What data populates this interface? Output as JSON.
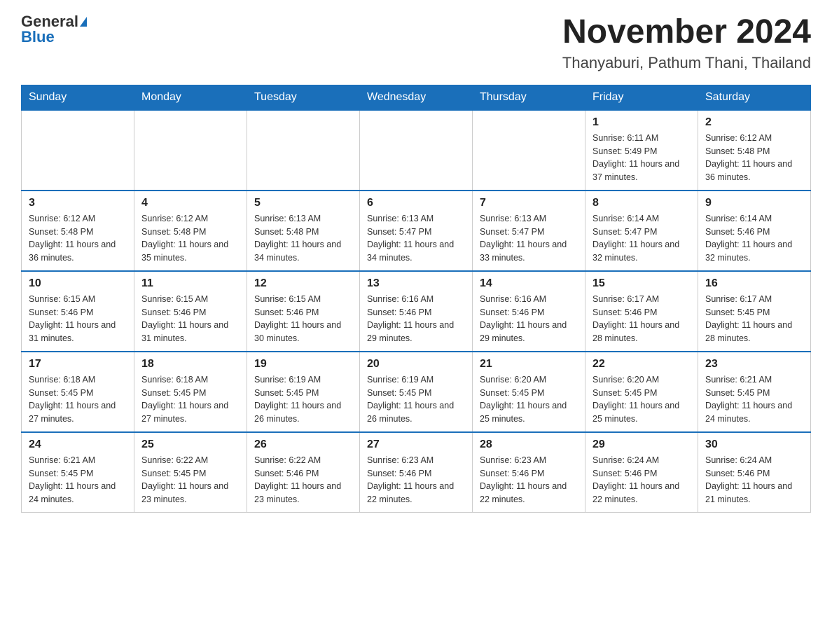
{
  "header": {
    "logo_general": "General",
    "logo_blue": "Blue",
    "month_title": "November 2024",
    "location": "Thanyaburi, Pathum Thani, Thailand"
  },
  "weekdays": [
    "Sunday",
    "Monday",
    "Tuesday",
    "Wednesday",
    "Thursday",
    "Friday",
    "Saturday"
  ],
  "weeks": [
    [
      {
        "day": "",
        "info": ""
      },
      {
        "day": "",
        "info": ""
      },
      {
        "day": "",
        "info": ""
      },
      {
        "day": "",
        "info": ""
      },
      {
        "day": "",
        "info": ""
      },
      {
        "day": "1",
        "info": "Sunrise: 6:11 AM\nSunset: 5:49 PM\nDaylight: 11 hours and 37 minutes."
      },
      {
        "day": "2",
        "info": "Sunrise: 6:12 AM\nSunset: 5:48 PM\nDaylight: 11 hours and 36 minutes."
      }
    ],
    [
      {
        "day": "3",
        "info": "Sunrise: 6:12 AM\nSunset: 5:48 PM\nDaylight: 11 hours and 36 minutes."
      },
      {
        "day": "4",
        "info": "Sunrise: 6:12 AM\nSunset: 5:48 PM\nDaylight: 11 hours and 35 minutes."
      },
      {
        "day": "5",
        "info": "Sunrise: 6:13 AM\nSunset: 5:48 PM\nDaylight: 11 hours and 34 minutes."
      },
      {
        "day": "6",
        "info": "Sunrise: 6:13 AM\nSunset: 5:47 PM\nDaylight: 11 hours and 34 minutes."
      },
      {
        "day": "7",
        "info": "Sunrise: 6:13 AM\nSunset: 5:47 PM\nDaylight: 11 hours and 33 minutes."
      },
      {
        "day": "8",
        "info": "Sunrise: 6:14 AM\nSunset: 5:47 PM\nDaylight: 11 hours and 32 minutes."
      },
      {
        "day": "9",
        "info": "Sunrise: 6:14 AM\nSunset: 5:46 PM\nDaylight: 11 hours and 32 minutes."
      }
    ],
    [
      {
        "day": "10",
        "info": "Sunrise: 6:15 AM\nSunset: 5:46 PM\nDaylight: 11 hours and 31 minutes."
      },
      {
        "day": "11",
        "info": "Sunrise: 6:15 AM\nSunset: 5:46 PM\nDaylight: 11 hours and 31 minutes."
      },
      {
        "day": "12",
        "info": "Sunrise: 6:15 AM\nSunset: 5:46 PM\nDaylight: 11 hours and 30 minutes."
      },
      {
        "day": "13",
        "info": "Sunrise: 6:16 AM\nSunset: 5:46 PM\nDaylight: 11 hours and 29 minutes."
      },
      {
        "day": "14",
        "info": "Sunrise: 6:16 AM\nSunset: 5:46 PM\nDaylight: 11 hours and 29 minutes."
      },
      {
        "day": "15",
        "info": "Sunrise: 6:17 AM\nSunset: 5:46 PM\nDaylight: 11 hours and 28 minutes."
      },
      {
        "day": "16",
        "info": "Sunrise: 6:17 AM\nSunset: 5:45 PM\nDaylight: 11 hours and 28 minutes."
      }
    ],
    [
      {
        "day": "17",
        "info": "Sunrise: 6:18 AM\nSunset: 5:45 PM\nDaylight: 11 hours and 27 minutes."
      },
      {
        "day": "18",
        "info": "Sunrise: 6:18 AM\nSunset: 5:45 PM\nDaylight: 11 hours and 27 minutes."
      },
      {
        "day": "19",
        "info": "Sunrise: 6:19 AM\nSunset: 5:45 PM\nDaylight: 11 hours and 26 minutes."
      },
      {
        "day": "20",
        "info": "Sunrise: 6:19 AM\nSunset: 5:45 PM\nDaylight: 11 hours and 26 minutes."
      },
      {
        "day": "21",
        "info": "Sunrise: 6:20 AM\nSunset: 5:45 PM\nDaylight: 11 hours and 25 minutes."
      },
      {
        "day": "22",
        "info": "Sunrise: 6:20 AM\nSunset: 5:45 PM\nDaylight: 11 hours and 25 minutes."
      },
      {
        "day": "23",
        "info": "Sunrise: 6:21 AM\nSunset: 5:45 PM\nDaylight: 11 hours and 24 minutes."
      }
    ],
    [
      {
        "day": "24",
        "info": "Sunrise: 6:21 AM\nSunset: 5:45 PM\nDaylight: 11 hours and 24 minutes."
      },
      {
        "day": "25",
        "info": "Sunrise: 6:22 AM\nSunset: 5:45 PM\nDaylight: 11 hours and 23 minutes."
      },
      {
        "day": "26",
        "info": "Sunrise: 6:22 AM\nSunset: 5:46 PM\nDaylight: 11 hours and 23 minutes."
      },
      {
        "day": "27",
        "info": "Sunrise: 6:23 AM\nSunset: 5:46 PM\nDaylight: 11 hours and 22 minutes."
      },
      {
        "day": "28",
        "info": "Sunrise: 6:23 AM\nSunset: 5:46 PM\nDaylight: 11 hours and 22 minutes."
      },
      {
        "day": "29",
        "info": "Sunrise: 6:24 AM\nSunset: 5:46 PM\nDaylight: 11 hours and 22 minutes."
      },
      {
        "day": "30",
        "info": "Sunrise: 6:24 AM\nSunset: 5:46 PM\nDaylight: 11 hours and 21 minutes."
      }
    ]
  ]
}
